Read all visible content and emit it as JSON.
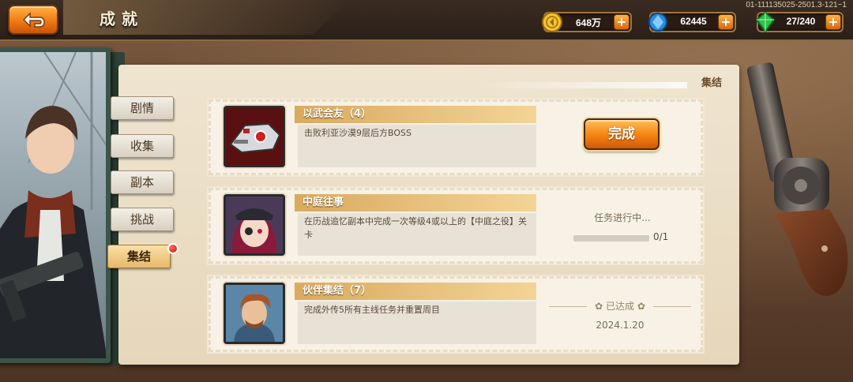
{
  "header": {
    "title": "成就",
    "build_id": "01-111135025-2501.3-121~1",
    "back_icon": "return-arrow-icon"
  },
  "resources": [
    {
      "name": "gold",
      "icon": "gold-coin-icon",
      "value": "648万"
    },
    {
      "name": "diamond",
      "icon": "blue-crystal-icon",
      "value": "62445"
    },
    {
      "name": "stamina",
      "icon": "green-gem-icon",
      "value": "27/240"
    }
  ],
  "resource_plus": "+",
  "panel": {
    "section_label": "集结"
  },
  "tabs": [
    {
      "label": "剧情",
      "active": false
    },
    {
      "label": "收集",
      "active": false
    },
    {
      "label": "副本",
      "active": false
    },
    {
      "label": "挑战",
      "active": false
    },
    {
      "label": "集结",
      "active": true,
      "badge": true
    }
  ],
  "achievements": [
    {
      "title": "以武会友（4）",
      "description": "击败利亚沙漠9层后方BOSS",
      "status": "complete",
      "button_label": "完成"
    },
    {
      "title": "中庭往事",
      "description": "在历战追忆副本中完成一次等级4或以上的【中庭之役】关卡",
      "status": "in_progress",
      "status_text": "任务进行中...",
      "progress": 0,
      "progress_text": "0/1"
    },
    {
      "title": "伙伴集结（7）",
      "description": "完成外传5所有主线任务并重置周目",
      "status": "reached",
      "status_text": "已达成",
      "date": "2024.1.20"
    }
  ],
  "colors": {
    "accent_orange": "#f3820f",
    "title_bar": "#d9aa5e",
    "panel_bg": "#efe4cf"
  }
}
